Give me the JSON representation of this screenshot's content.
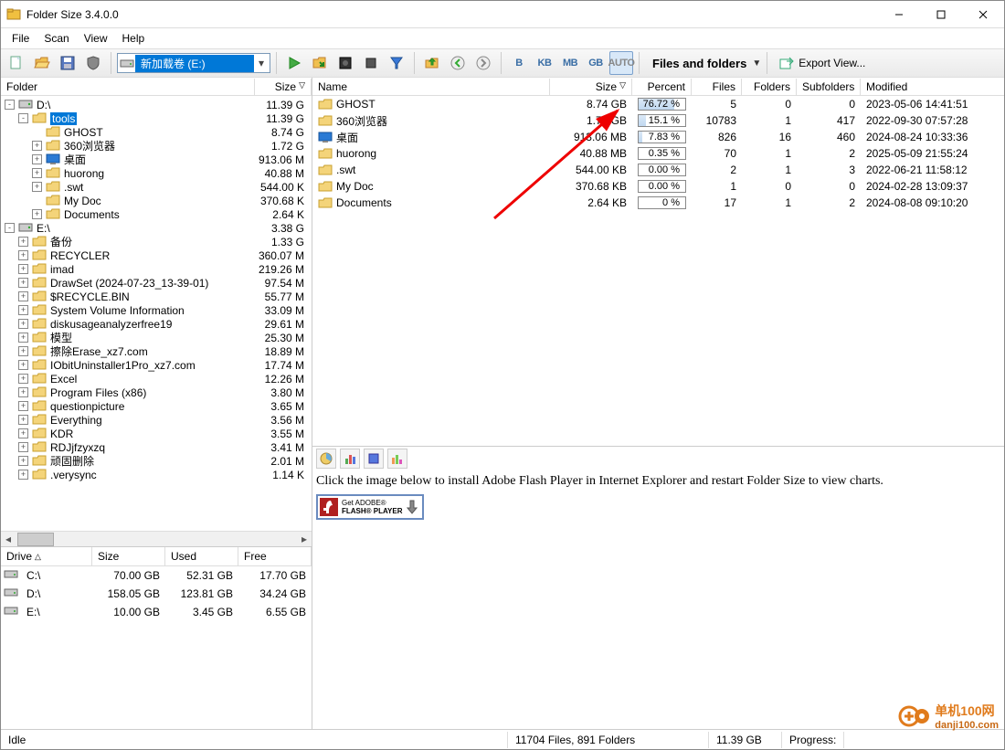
{
  "window": {
    "title": "Folder Size 3.4.0.0"
  },
  "menu": {
    "file": "File",
    "scan": "Scan",
    "view": "View",
    "help": "Help"
  },
  "toolbar": {
    "drive_selected": "新加载卷 (E:)",
    "files_folders": "Files and folders",
    "export": "Export View..."
  },
  "units": {
    "b": "B",
    "kb": "KB",
    "mb": "MB",
    "gb": "GB",
    "auto": "AUTO"
  },
  "tree_hdr": {
    "folder": "Folder",
    "size": "Size"
  },
  "tree": [
    {
      "depth": 0,
      "tw": "-",
      "icon": "drive",
      "label": "D:\\",
      "size": "11.39 G"
    },
    {
      "depth": 1,
      "tw": "-",
      "icon": "folder",
      "label": "tools",
      "size": "11.39 G",
      "sel": true
    },
    {
      "depth": 2,
      "tw": "",
      "icon": "folder",
      "label": "GHOST",
      "size": "8.74 G"
    },
    {
      "depth": 2,
      "tw": "+",
      "icon": "folder",
      "label": "360浏览器",
      "size": "1.72 G"
    },
    {
      "depth": 2,
      "tw": "+",
      "icon": "desktop",
      "label": "桌面",
      "size": "913.06 M"
    },
    {
      "depth": 2,
      "tw": "+",
      "icon": "folder",
      "label": "huorong",
      "size": "40.88 M"
    },
    {
      "depth": 2,
      "tw": "+",
      "icon": "folder",
      "label": ".swt",
      "size": "544.00 K"
    },
    {
      "depth": 2,
      "tw": "",
      "icon": "folder",
      "label": "My Doc",
      "size": "370.68 K"
    },
    {
      "depth": 2,
      "tw": "+",
      "icon": "folder",
      "label": "Documents",
      "size": "2.64 K"
    },
    {
      "depth": 0,
      "tw": "-",
      "icon": "drive",
      "label": "E:\\",
      "size": "3.38 G"
    },
    {
      "depth": 1,
      "tw": "+",
      "icon": "folder",
      "label": "备份",
      "size": "1.33 G"
    },
    {
      "depth": 1,
      "tw": "+",
      "icon": "folder",
      "label": "RECYCLER",
      "size": "360.07 M"
    },
    {
      "depth": 1,
      "tw": "+",
      "icon": "folder",
      "label": "imad",
      "size": "219.26 M"
    },
    {
      "depth": 1,
      "tw": "+",
      "icon": "folder",
      "label": "DrawSet (2024-07-23_13-39-01)",
      "size": "97.54 M"
    },
    {
      "depth": 1,
      "tw": "+",
      "icon": "folder",
      "label": "$RECYCLE.BIN",
      "size": "55.77 M"
    },
    {
      "depth": 1,
      "tw": "+",
      "icon": "folder",
      "label": "System Volume Information",
      "size": "33.09 M"
    },
    {
      "depth": 1,
      "tw": "+",
      "icon": "folder",
      "label": "diskusageanalyzerfree19",
      "size": "29.61 M"
    },
    {
      "depth": 1,
      "tw": "+",
      "icon": "folder",
      "label": "模型",
      "size": "25.30 M"
    },
    {
      "depth": 1,
      "tw": "+",
      "icon": "folder",
      "label": "擦除Erase_xz7.com",
      "size": "18.89 M"
    },
    {
      "depth": 1,
      "tw": "+",
      "icon": "folder",
      "label": "IObitUninstaller1Pro_xz7.com",
      "size": "17.74 M"
    },
    {
      "depth": 1,
      "tw": "+",
      "icon": "folder",
      "label": "Excel",
      "size": "12.26 M"
    },
    {
      "depth": 1,
      "tw": "+",
      "icon": "folder",
      "label": "Program Files (x86)",
      "size": "3.80 M"
    },
    {
      "depth": 1,
      "tw": "+",
      "icon": "folder",
      "label": "questionpicture",
      "size": "3.65 M"
    },
    {
      "depth": 1,
      "tw": "+",
      "icon": "folder",
      "label": "Everything",
      "size": "3.56 M"
    },
    {
      "depth": 1,
      "tw": "+",
      "icon": "folder",
      "label": "KDR",
      "size": "3.55 M"
    },
    {
      "depth": 1,
      "tw": "+",
      "icon": "folder",
      "label": "RDJjfzyxzq",
      "size": "3.41 M"
    },
    {
      "depth": 1,
      "tw": "+",
      "icon": "folder",
      "label": "顽固删除",
      "size": "2.01 M"
    },
    {
      "depth": 1,
      "tw": "+",
      "icon": "folder",
      "label": ".verysync",
      "size": "1.14 K"
    }
  ],
  "drives_hdr": {
    "drive": "Drive",
    "size": "Size",
    "used": "Used",
    "free": "Free"
  },
  "drives": [
    {
      "name": "C:\\",
      "size": "70.00 GB",
      "used": "52.31 GB",
      "free": "17.70 GB"
    },
    {
      "name": "D:\\",
      "size": "158.05 GB",
      "used": "123.81 GB",
      "free": "34.24 GB"
    },
    {
      "name": "E:\\",
      "size": "10.00 GB",
      "used": "3.45 GB",
      "free": "6.55 GB"
    }
  ],
  "list_hdr": {
    "name": "Name",
    "size": "Size",
    "percent": "Percent",
    "files": "Files",
    "folders": "Folders",
    "subfolders": "Subfolders",
    "modified": "Modified"
  },
  "list": [
    {
      "icon": "folder",
      "name": "GHOST",
      "size": "8.74 GB",
      "pct": "76.72 %",
      "pctv": 76.72,
      "files": "5",
      "folders": "0",
      "sub": "0",
      "mod": "2023-05-06 14:41:51"
    },
    {
      "icon": "folder",
      "name": "360浏览器",
      "size": "1.72 GB",
      "pct": "15.1 %",
      "pctv": 15.1,
      "files": "10783",
      "folders": "1",
      "sub": "417",
      "mod": "2022-09-30 07:57:28"
    },
    {
      "icon": "desktop",
      "name": "桌面",
      "size": "913.06 MB",
      "pct": "7.83 %",
      "pctv": 7.83,
      "files": "826",
      "folders": "16",
      "sub": "460",
      "mod": "2024-08-24 10:33:36"
    },
    {
      "icon": "folder",
      "name": "huorong",
      "size": "40.88 MB",
      "pct": "0.35 %",
      "pctv": 0.35,
      "files": "70",
      "folders": "1",
      "sub": "2",
      "mod": "2025-05-09 21:55:24"
    },
    {
      "icon": "folder",
      "name": ".swt",
      "size": "544.00 KB",
      "pct": "0.00 %",
      "pctv": 0,
      "files": "2",
      "folders": "1",
      "sub": "3",
      "mod": "2022-06-21 11:58:12"
    },
    {
      "icon": "folder",
      "name": "My Doc",
      "size": "370.68 KB",
      "pct": "0.00 %",
      "pctv": 0,
      "files": "1",
      "folders": "0",
      "sub": "0",
      "mod": "2024-02-28 13:09:37"
    },
    {
      "icon": "folder",
      "name": "Documents",
      "size": "2.64 KB",
      "pct": "0 %",
      "pctv": 0,
      "files": "17",
      "folders": "1",
      "sub": "2",
      "mod": "2024-08-08 09:10:20"
    }
  ],
  "flash": {
    "msg": "Click the image below to install Adobe Flash Player in Internet Explorer and restart Folder Size to view charts.",
    "l1": "Get ADOBE®",
    "l2": "FLASH® PLAYER"
  },
  "status": {
    "idle": "Idle",
    "files": "11704 Files, 891 Folders",
    "size": "11.39 GB",
    "progress": "Progress:"
  },
  "wm": {
    "a": "单机100网",
    "b": "danji100.com"
  }
}
